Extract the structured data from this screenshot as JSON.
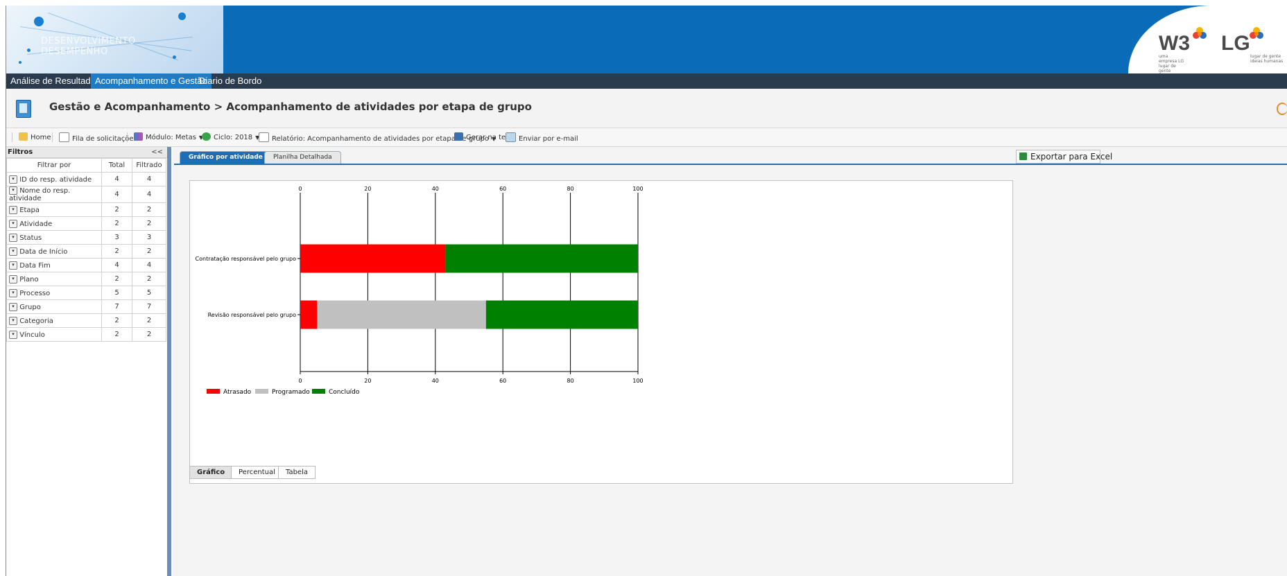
{
  "banner": {
    "title_line1": "DESENVOLVIMENTO",
    "title_line2": "DESEMPENHO",
    "logo_w3": "W3",
    "logo_lg": "LG",
    "w3_sub": "uma empresa LG lugar de gente",
    "lg_sub": "lugar de gente ideias humanas"
  },
  "menu": {
    "items": [
      "Análise de Resultados",
      "Acompanhamento e Gestão",
      "Diario de Bordo"
    ],
    "active": "Acompanhamento e Gestão"
  },
  "page": {
    "title": "Gestão e Acompanhamento > Acompanhamento de atividades por etapa de grupo"
  },
  "toolbar": {
    "home": "Home",
    "fila": "Fila de solicitações",
    "modulo": "Módulo: Metas",
    "ciclo": "Ciclo: 2018",
    "relatorio": "Relatório: Acompanhamento de atividades por etapa de grupo",
    "gerar": "Gerar na tela",
    "enviar": "Enviar por e-mail"
  },
  "filters": {
    "title": "Filtros",
    "collapse": "<<",
    "headers": [
      "Filtrar por",
      "Total",
      "Filtrado"
    ],
    "rows": [
      {
        "label": "ID do resp. atividade",
        "total": "4",
        "filtered": "4"
      },
      {
        "label": "Nome do resp. atividade",
        "total": "4",
        "filtered": "4"
      },
      {
        "label": "Etapa",
        "total": "2",
        "filtered": "2"
      },
      {
        "label": "Atividade",
        "total": "2",
        "filtered": "2"
      },
      {
        "label": "Status",
        "total": "3",
        "filtered": "3"
      },
      {
        "label": "Data de Início",
        "total": "2",
        "filtered": "2"
      },
      {
        "label": "Data Fim",
        "total": "4",
        "filtered": "4"
      },
      {
        "label": "Plano",
        "total": "2",
        "filtered": "2"
      },
      {
        "label": "Processo",
        "total": "5",
        "filtered": "5"
      },
      {
        "label": "Grupo",
        "total": "7",
        "filtered": "7"
      },
      {
        "label": "Categoria",
        "total": "2",
        "filtered": "2"
      },
      {
        "label": "Vínculo",
        "total": "2",
        "filtered": "2"
      }
    ]
  },
  "tabs": {
    "chart": "Gráfico por atividade",
    "sheet": "Planilha Detalhada"
  },
  "export": "Exportar para Excel",
  "bottom_tabs": [
    "Gráfico",
    "Percentual",
    "Tabela"
  ],
  "colors": {
    "atrasado": "#ff0000",
    "programado": "#c0c0c0",
    "concluido": "#008000"
  },
  "chart_data": {
    "type": "bar",
    "orientation": "horizontal",
    "stacked": true,
    "categories": [
      "Contratação responsável pelo grupo",
      "Revisão responsável pelo grupo"
    ],
    "series": [
      {
        "name": "Atrasado",
        "values": [
          43,
          5
        ]
      },
      {
        "name": "Programado",
        "values": [
          0,
          50
        ]
      },
      {
        "name": "Concluído",
        "values": [
          57,
          45
        ]
      }
    ],
    "xlim": [
      0,
      100
    ],
    "ticks": [
      "0",
      "20",
      "40",
      "60",
      "80",
      "100"
    ],
    "grid": true,
    "legend": "bottom-left"
  }
}
